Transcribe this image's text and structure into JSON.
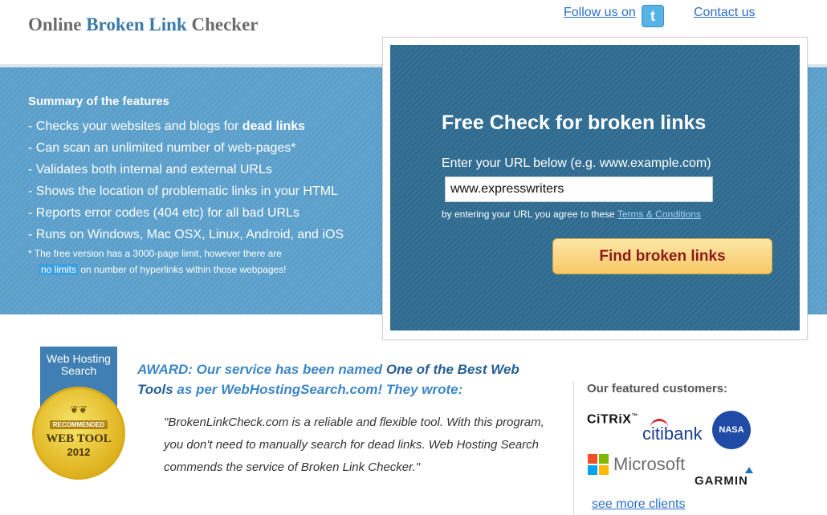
{
  "header": {
    "title_part1": "Online ",
    "title_accent": "Broken Link",
    "title_part2": " Checker",
    "follow_label": "Follow us on",
    "twitter_glyph": "t",
    "contact_label": "Contact us"
  },
  "features": {
    "heading": "Summary of the features",
    "item1_prefix": "- Checks your websites and blogs for ",
    "item1_bold": "dead links",
    "item2": "- Can scan an unlimited number of web-pages*",
    "item3": "- Validates both internal and external URLs",
    "item4": "- Shows the location of problematic links in your HTML",
    "item5": "- Reports error codes (404 etc) for all bad URLs",
    "item6": "- Runs on Windows, Mac OSX, Linux, Android, and iOS",
    "footnote_line1": "*  The free version has a 3000-page limit, however there are",
    "footnote_highlight": "no limits",
    "footnote_line2": " on number of hyperlinks within those webpages!"
  },
  "check_panel": {
    "heading": "Free Check for broken links",
    "url_label": "Enter your URL below (e.g. www.example.com)",
    "url_value": "www.expresswriters",
    "agree_prefix": "by entering your URL you agree to these ",
    "terms_link": "Terms & Conditions",
    "button_label": "Find broken links"
  },
  "award": {
    "badge_top": "Web Hosting Search",
    "badge_recommended": "RECOMMENDED",
    "badge_web_tool": "WEB TOOL",
    "badge_year": "2012",
    "text_part1": "AWARD: Our service has been named ",
    "text_highlight": "One of the Best Web Tools",
    "text_part2": " as per WebHostingSearch.com! They wrote:",
    "quote": "\"BrokenLinkCheck.com is a reliable and flexible tool. With this program, you don't need to manually search for dead links. Web Hosting Search commends the service of Broken Link Checker.\""
  },
  "customers": {
    "heading": "Our featured customers:",
    "citrix": "CiTRiX",
    "citibank": "citibank",
    "nasa": "NASA",
    "microsoft": "Microsoft",
    "garmin": "GARMIN",
    "more_link": "see more clients"
  },
  "colors": {
    "band": "#5b9fcb",
    "panel": "#2f6b90",
    "accent": "#3c7aa6",
    "button": "#f7c865",
    "button_text": "#8c1a1a"
  }
}
